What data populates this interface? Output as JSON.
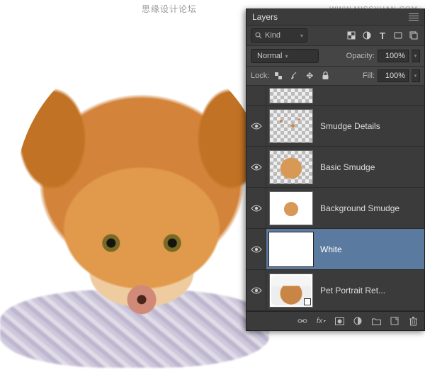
{
  "watermark": {
    "cn": "思缘设计论坛",
    "url": "WWW.MISSYUAN.COM"
  },
  "panel": {
    "title": "Layers",
    "filter": {
      "kind": "Kind"
    },
    "blend": {
      "mode": "Normal",
      "opacity_label": "Opacity:",
      "opacity_value": "100%"
    },
    "lock": {
      "label": "Lock:",
      "fill_label": "Fill:",
      "fill_value": "100%"
    },
    "layers": [
      {
        "name": "",
        "visible": true,
        "type": "checker_partial"
      },
      {
        "name": "Smudge Details",
        "visible": true,
        "type": "checker_sparse"
      },
      {
        "name": "Basic Smudge",
        "visible": true,
        "type": "checker_dog"
      },
      {
        "name": "Background Smudge",
        "visible": true,
        "type": "white_dog"
      },
      {
        "name": "White",
        "visible": true,
        "type": "white",
        "selected": true
      },
      {
        "name": "Pet Portrait Ret...",
        "visible": true,
        "type": "full_photo",
        "smart": true
      }
    ]
  }
}
